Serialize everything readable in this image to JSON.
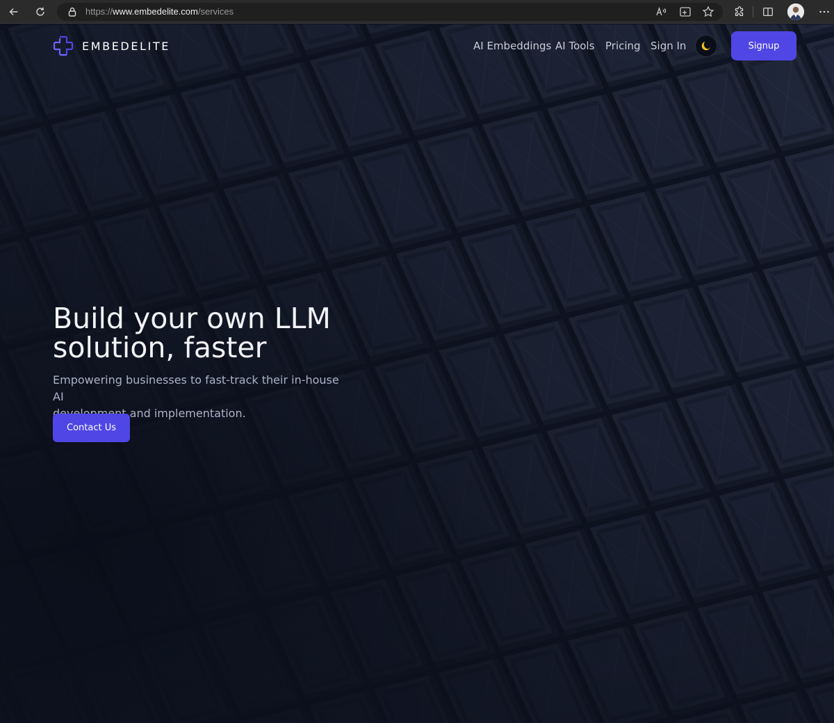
{
  "browser": {
    "url_prefix": "https://",
    "url_host": "www.embedelite.com",
    "url_path": "/services",
    "icons": {
      "back": "back-arrow-icon",
      "reload": "reload-icon",
      "lock": "lock-icon",
      "read_aloud": "read-aloud-icon",
      "app_available": "app-available-icon",
      "favorite": "star-icon",
      "extensions": "puzzle-icon",
      "split_screen": "split-screen-icon",
      "more": "more-dots-icon"
    }
  },
  "site": {
    "brand": "EMBEDELITE",
    "nav": {
      "ai_embeddings": "AI Embeddings",
      "ai_tools": "AI Tools",
      "pricing": "Pricing",
      "sign_in": "Sign In",
      "signup": "Signup"
    },
    "theme_toggle_icon": "moon-icon",
    "hero": {
      "title_line1": "Build your own LLM",
      "title_line2": "solution, faster",
      "subtitle_line1": "Empowering businesses to fast-track their in-house AI",
      "subtitle_line2": "development and implementation.",
      "cta": "Contact Us"
    }
  },
  "colors": {
    "accent": "#4f46e5",
    "background": "#111726",
    "moon": "#f5c518"
  }
}
